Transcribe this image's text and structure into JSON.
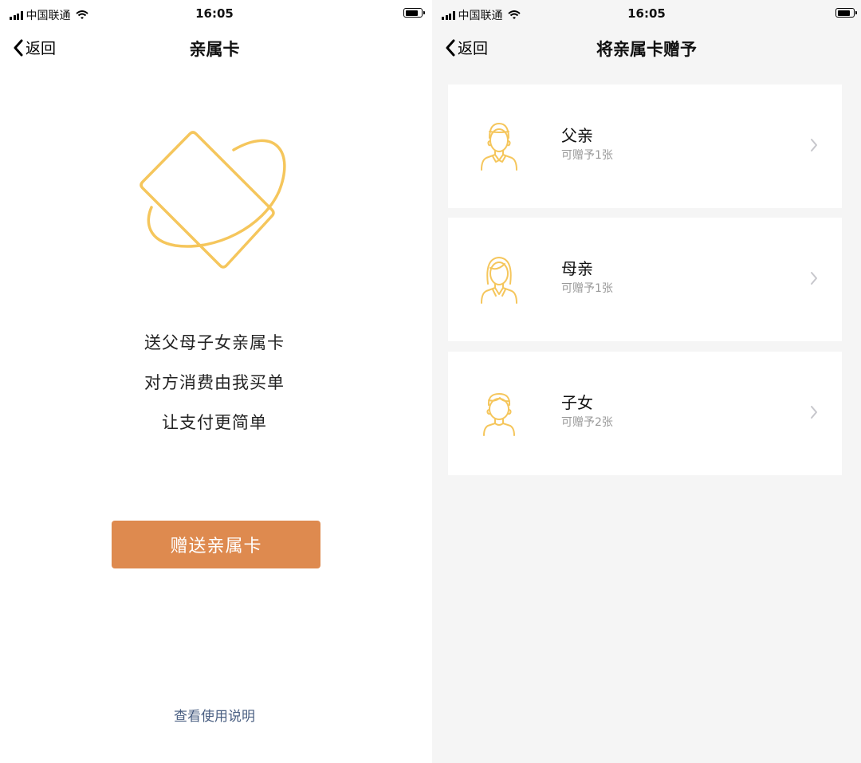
{
  "status_bar": {
    "carrier": "中国联通",
    "time": "16:05"
  },
  "left_screen": {
    "back_label": "返回",
    "title": "亲属卡",
    "promo_lines": [
      "送父母子女亲属卡",
      "对方消费由我买单",
      "让支付更简单"
    ],
    "gift_button_label": "赠送亲属卡",
    "help_link": "查看使用说明",
    "accent_color": "#de8a4f",
    "illustration_color": "#f5c65c"
  },
  "right_screen": {
    "back_label": "返回",
    "title": "将亲属卡赠予",
    "recipients": [
      {
        "name": "父亲",
        "subtitle": "可赠予1张",
        "icon": "father-avatar-icon"
      },
      {
        "name": "母亲",
        "subtitle": "可赠予1张",
        "icon": "mother-avatar-icon"
      },
      {
        "name": "子女",
        "subtitle": "可赠予2张",
        "icon": "child-avatar-icon"
      }
    ]
  }
}
